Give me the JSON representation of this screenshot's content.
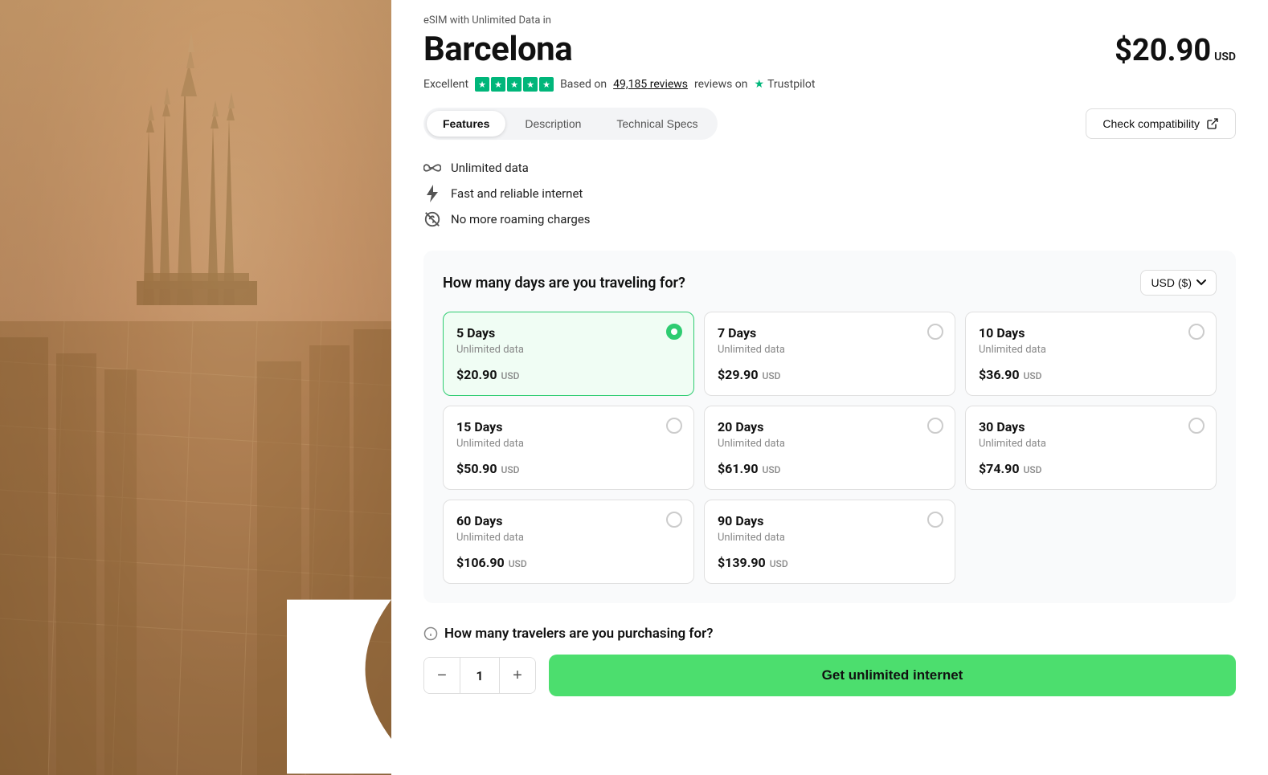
{
  "header": {
    "subtitle": "eSIM with Unlimited Data in",
    "city": "Barcelona",
    "price": "$20.90",
    "price_currency": "USD"
  },
  "rating": {
    "label": "Excellent",
    "review_count": "49,185",
    "review_text": "Based on",
    "reviews_suffix": "reviews on",
    "trustpilot": "Trustpilot"
  },
  "tabs": [
    {
      "id": "features",
      "label": "Features",
      "active": true
    },
    {
      "id": "description",
      "label": "Description",
      "active": false
    },
    {
      "id": "technical-specs",
      "label": "Technical Specs",
      "active": false
    }
  ],
  "check_compat": {
    "label": "Check compatibility"
  },
  "features": [
    {
      "icon": "infinity",
      "text": "Unlimited data"
    },
    {
      "icon": "bolt",
      "text": "Fast and reliable internet"
    },
    {
      "icon": "no-roaming",
      "text": "No more roaming charges"
    }
  ],
  "days_section": {
    "question": "How many days are you traveling for?",
    "currency": "USD ($)",
    "plans": [
      {
        "id": "5d",
        "days": "5 Days",
        "data": "Unlimited data",
        "price": "$20.90",
        "currency": "USD",
        "selected": true
      },
      {
        "id": "7d",
        "days": "7 Days",
        "data": "Unlimited data",
        "price": "$29.90",
        "currency": "USD",
        "selected": false
      },
      {
        "id": "10d",
        "days": "10 Days",
        "data": "Unlimited data",
        "price": "$36.90",
        "currency": "USD",
        "selected": false
      },
      {
        "id": "15d",
        "days": "15 Days",
        "data": "Unlimited data",
        "price": "$50.90",
        "currency": "USD",
        "selected": false
      },
      {
        "id": "20d",
        "days": "20 Days",
        "data": "Unlimited data",
        "price": "$61.90",
        "currency": "USD",
        "selected": false
      },
      {
        "id": "30d",
        "days": "30 Days",
        "data": "Unlimited data",
        "price": "$74.90",
        "currency": "USD",
        "selected": false
      },
      {
        "id": "60d",
        "days": "60 Days",
        "data": "Unlimited data",
        "price": "$106.90",
        "currency": "USD",
        "selected": false
      },
      {
        "id": "90d",
        "days": "90 Days",
        "data": "Unlimited data",
        "price": "$139.90",
        "currency": "USD",
        "selected": false
      }
    ]
  },
  "travelers": {
    "question": "How many travelers are you purchasing for?",
    "count": "1",
    "stepper_minus": "−",
    "stepper_plus": "+"
  },
  "cta": {
    "label": "Get unlimited internet"
  }
}
